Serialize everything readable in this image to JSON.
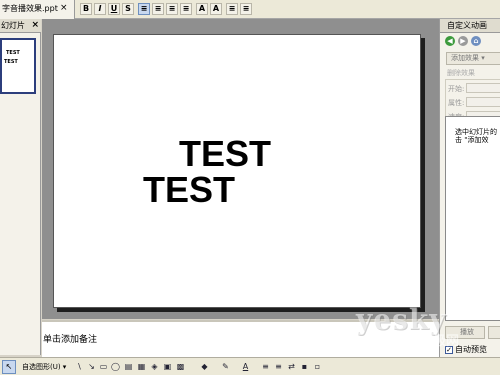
{
  "window": {
    "doc_tab_title": "字音播效果.ppt",
    "doc_tab_close": "×"
  },
  "toolbar": {
    "buttons": [
      "B",
      "I",
      "U",
      "S",
      "≡",
      "≡",
      "≡",
      "≡",
      "A",
      "A",
      "≡",
      "≡"
    ]
  },
  "left_pane": {
    "tab_label": "幻灯片",
    "close": "×",
    "thumbnail_text": [
      "TEST",
      "TEST"
    ]
  },
  "slide": {
    "text_lines": [
      "TEST",
      "TEST"
    ]
  },
  "task_pane": {
    "title": "自定义动画",
    "add_effect": "添加效果 ▾",
    "remove_label": "删除效果",
    "fields": [
      {
        "label": "开始:"
      },
      {
        "label": "属性:"
      },
      {
        "label": "速度:"
      }
    ],
    "hint": "选中幻灯片的\n击 \"添加效",
    "play_button": "播放",
    "autopreview_label": "自动预览"
  },
  "notes": {
    "placeholder": "单击添加备注"
  },
  "draw_toolbar": {
    "select_icon": "↖",
    "autoshapes_label": "自选图形(U) ▾",
    "icons": [
      "\\",
      "↘",
      "▭",
      "◯",
      "▤",
      "▦",
      "◈",
      "▣",
      "▩",
      "◆",
      "✎",
      "A",
      "≡",
      "≡",
      "⇄",
      "▪",
      "▫"
    ]
  },
  "watermark": {
    "brand": "yesky",
    "sub": "天极网"
  },
  "colors": {
    "chrome": "#ece9d8",
    "pane": "#f4f2ea",
    "workspace": "#8f8f8f",
    "slide": "#ffffff",
    "accent": "#2c3e7c"
  }
}
